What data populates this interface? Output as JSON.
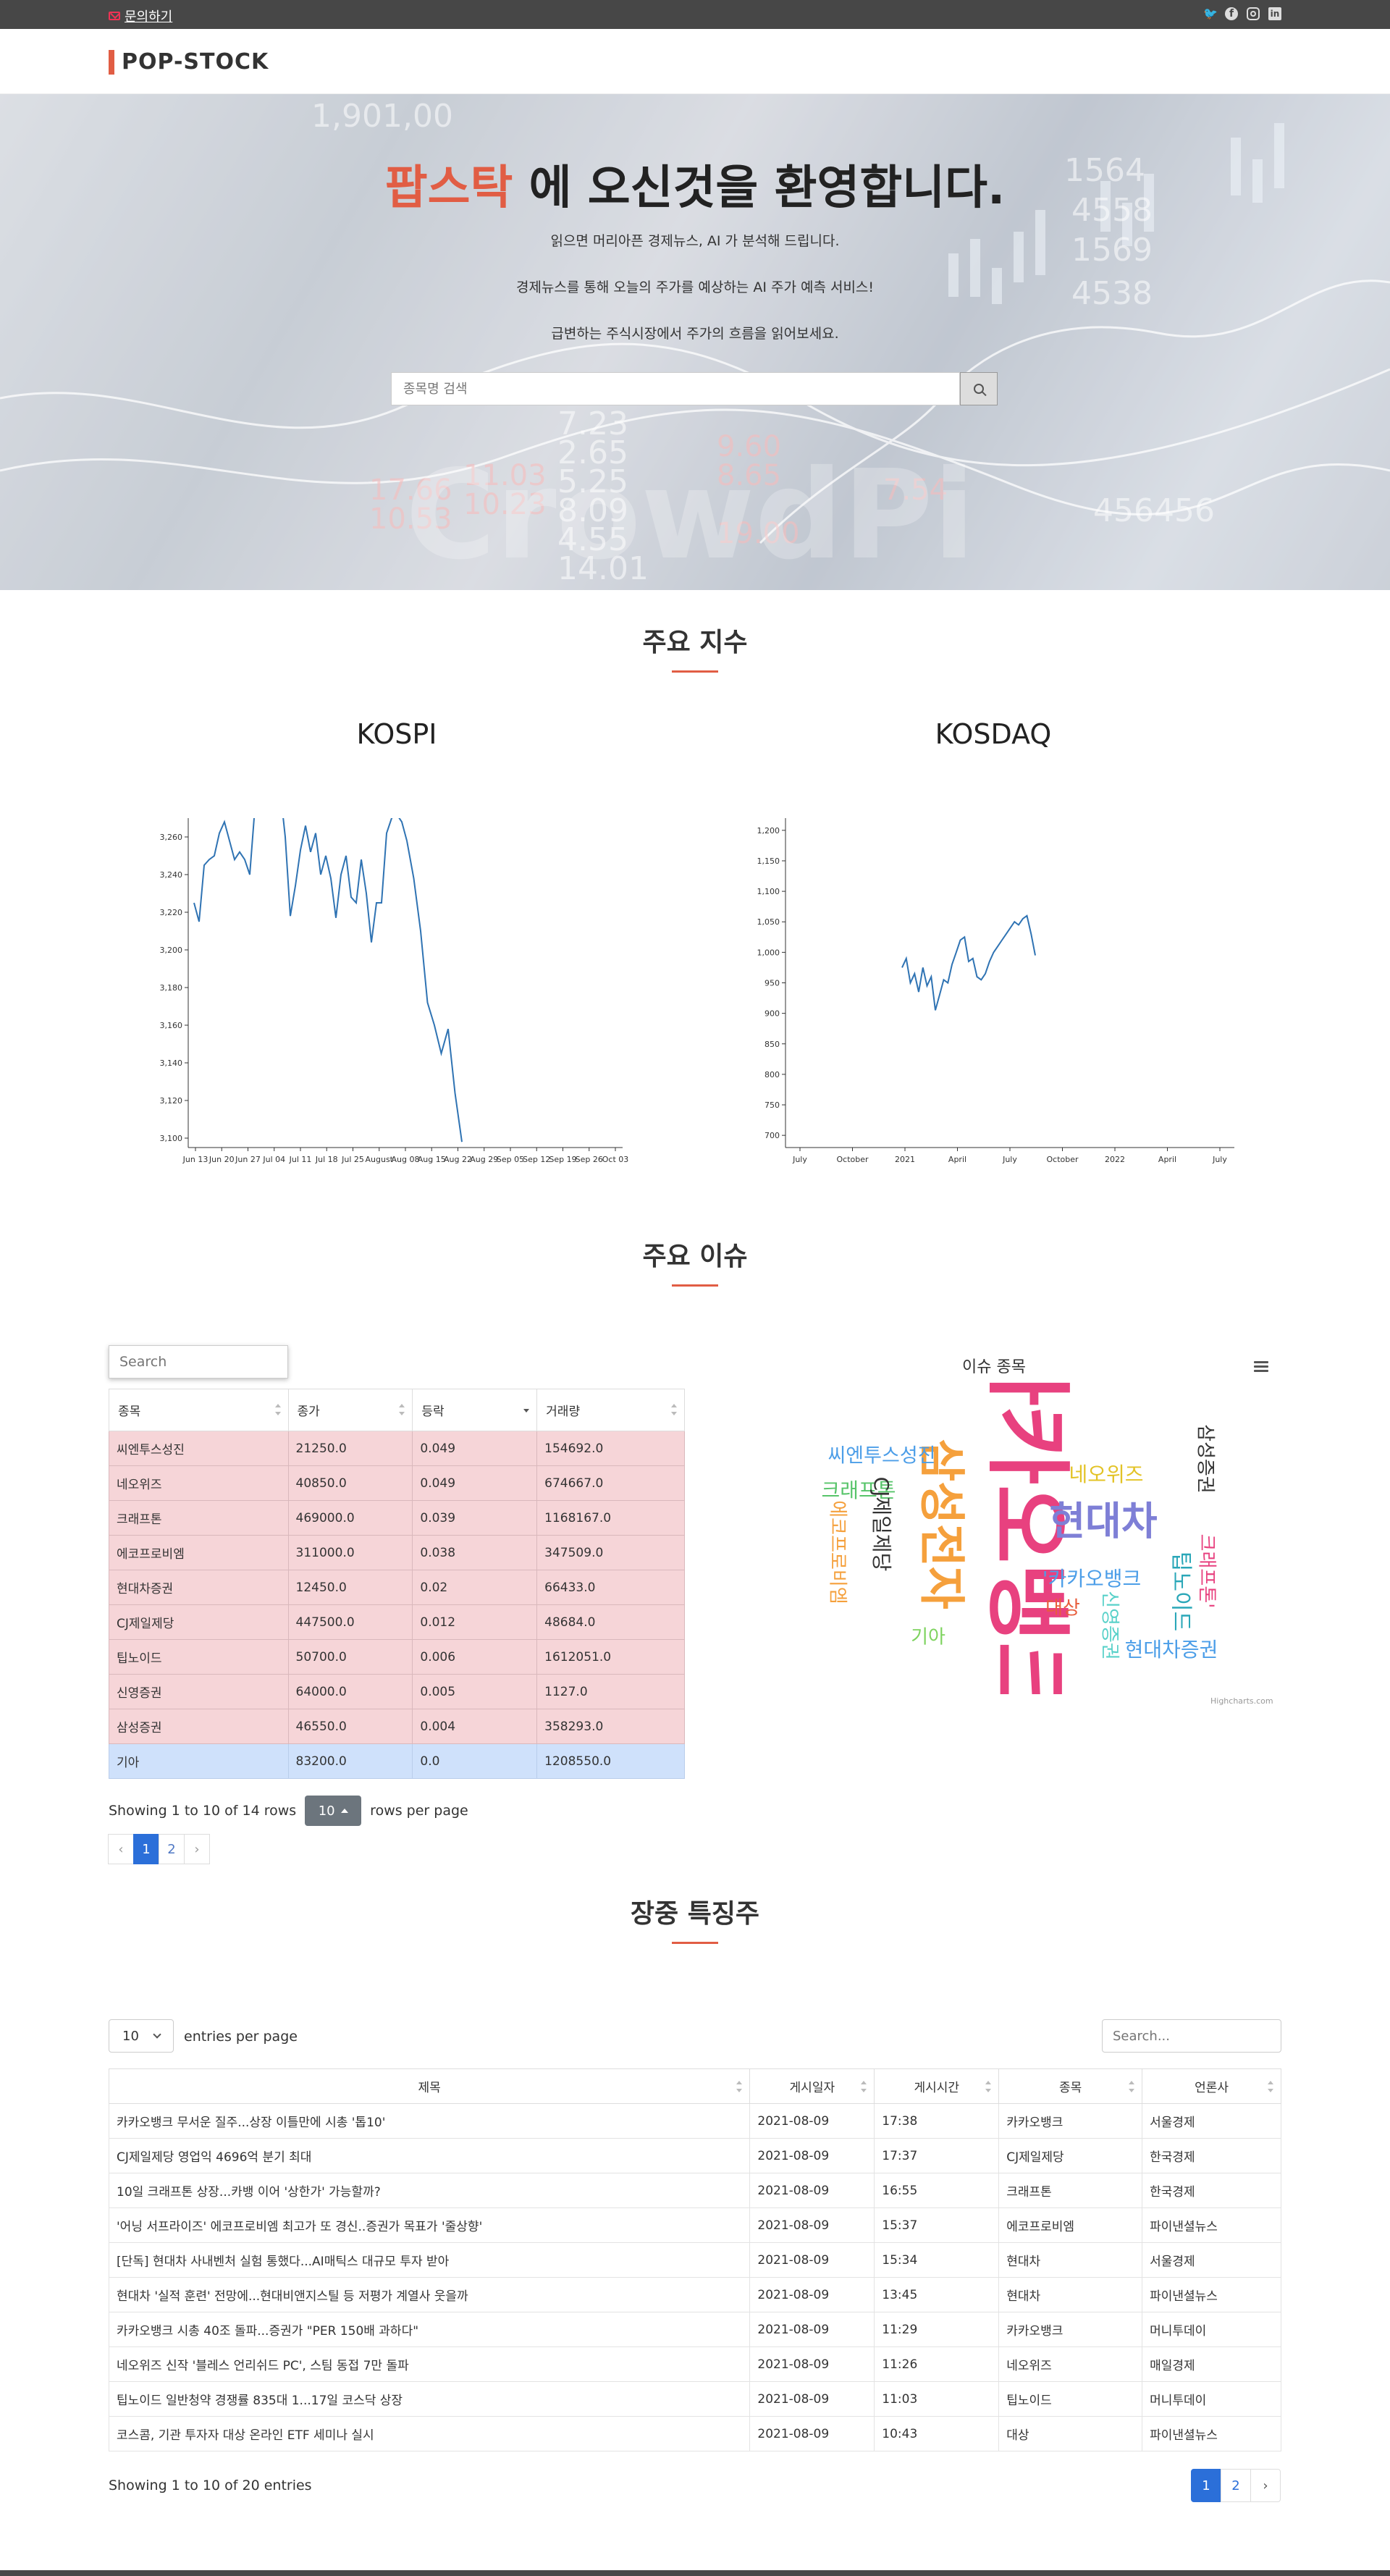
{
  "topbar": {
    "contact_label": "문의하기",
    "social_icons": [
      "twitter-icon",
      "facebook-icon",
      "instagram-icon",
      "linkedin-icon"
    ]
  },
  "header": {
    "logo": "POP-STOCK"
  },
  "hero": {
    "title_accent": "팝스탁",
    "title_rest": " 에 오신것을 환영합니다.",
    "lines": [
      "읽으면 머리아픈 경제뉴스, AI 가 분석해 드립니다.",
      "경제뉴스를 통해 오늘의 주가를 예상하는 AI 주가 예측 서비스!",
      "급변하는 주식시장에서 주가의 흐름을 읽어보세요."
    ],
    "search_placeholder": "종목명 검색"
  },
  "section_indices": {
    "title": "주요 지수"
  },
  "chart_data": [
    {
      "type": "line",
      "title": "KOSPI",
      "x_ticks": [
        "Jun 13",
        "Jun 20",
        "Jun 27",
        "Jul 04",
        "Jul 11",
        "Jul 18",
        "Jul 25",
        "August",
        "Aug 08",
        "Aug 15",
        "Aug 22",
        "Aug 29",
        "Sep 05",
        "Sep 12",
        "Sep 19",
        "Sep 26",
        "Oct 03"
      ],
      "y_ticks": [
        3100,
        3120,
        3140,
        3160,
        3180,
        3200,
        3220,
        3240,
        3260
      ],
      "ylim": [
        3095,
        3270
      ],
      "x": [
        "Jun 10",
        "Jun 11",
        "Jun 14",
        "Jun 15",
        "Jun 16",
        "Jun 17",
        "Jun 18",
        "Jun 21",
        "Jun 22",
        "Jun 23",
        "Jun 24",
        "Jun 25",
        "Jun 28",
        "Jun 29",
        "Jun 30",
        "Jul 01",
        "Jul 02",
        "Jul 05",
        "Jul 06",
        "Jul 07",
        "Jul 08",
        "Jul 09",
        "Jul 12",
        "Jul 13",
        "Jul 14",
        "Jul 15",
        "Jul 16",
        "Jul 19",
        "Jul 20",
        "Jul 21",
        "Jul 22",
        "Jul 23",
        "Jul 26",
        "Jul 27",
        "Jul 28",
        "Jul 29",
        "Jul 30",
        "Aug 02",
        "Aug 03",
        "Aug 04",
        "Aug 05",
        "Aug 06",
        "Aug 09"
      ],
      "values": [
        3225,
        3215,
        3245,
        3248,
        3250,
        3262,
        3268,
        3258,
        3248,
        3252,
        3248,
        3240,
        3275,
        3280,
        3285,
        3282,
        3278,
        3285,
        3260,
        3218,
        3234,
        3253,
        3266,
        3252,
        3262,
        3240,
        3250,
        3238,
        3217,
        3240,
        3250,
        3228,
        3225,
        3248,
        3230,
        3204,
        3225,
        3225,
        3262,
        3270,
        3272,
        3268,
        3258
      ],
      "series_tail": {
        "x": [
          "Aug 09",
          "Aug 10",
          "Aug 11",
          "Aug 12",
          "Aug 13",
          "Aug 16",
          "Aug 17",
          "Aug 18",
          "Aug 19"
        ],
        "values": [
          3258,
          3238,
          3210,
          3172,
          3160,
          3145,
          3158,
          3124,
          3098
        ]
      }
    },
    {
      "type": "line",
      "title": "KOSDAQ",
      "x_ticks": [
        "July",
        "October",
        "2021",
        "April",
        "July",
        "October",
        "2022",
        "April",
        "July"
      ],
      "y_ticks": [
        700,
        750,
        800,
        850,
        900,
        950,
        1000,
        1050,
        1100,
        1150,
        1200
      ],
      "ylim": [
        680,
        1220
      ],
      "x": [
        "2021-01-04",
        "2021-01-11",
        "2021-01-18",
        "2021-01-25",
        "2021-02-01",
        "2021-02-08",
        "2021-02-15",
        "2021-02-22",
        "2021-03-01",
        "2021-03-08",
        "2021-03-15",
        "2021-03-22",
        "2021-03-29",
        "2021-04-05",
        "2021-04-12",
        "2021-04-19",
        "2021-04-26",
        "2021-05-03",
        "2021-05-10",
        "2021-05-17",
        "2021-05-24",
        "2021-05-31",
        "2021-06-07",
        "2021-06-14",
        "2021-06-21",
        "2021-06-28",
        "2021-07-05",
        "2021-07-12",
        "2021-07-19",
        "2021-07-26",
        "2021-08-02",
        "2021-08-09",
        "2021-08-16"
      ],
      "values": [
        975,
        990,
        950,
        965,
        935,
        975,
        945,
        960,
        905,
        930,
        955,
        950,
        980,
        1000,
        1020,
        1025,
        985,
        990,
        960,
        955,
        965,
        985,
        1000,
        1010,
        1020,
        1030,
        1040,
        1050,
        1045,
        1055,
        1060,
        1030,
        995
      ]
    }
  ],
  "section_issues": {
    "title": "주요 이슈"
  },
  "issues_table": {
    "search_placeholder": "Search",
    "columns": [
      "종목",
      "종가",
      "등락",
      "거래량"
    ],
    "rows": [
      [
        "씨엔투스성진",
        "21250.0",
        "0.049",
        "154692.0"
      ],
      [
        "네오위즈",
        "40850.0",
        "0.049",
        "674667.0"
      ],
      [
        "크래프톤",
        "469000.0",
        "0.039",
        "1168167.0"
      ],
      [
        "에코프로비엠",
        "311000.0",
        "0.038",
        "347509.0"
      ],
      [
        "현대차증권",
        "12450.0",
        "0.02",
        "66433.0"
      ],
      [
        "CJ제일제당",
        "447500.0",
        "0.012",
        "48684.0"
      ],
      [
        "팁노이드",
        "50700.0",
        "0.006",
        "1612051.0"
      ],
      [
        "신영증권",
        "64000.0",
        "0.005",
        "1127.0"
      ],
      [
        "삼성증권",
        "46550.0",
        "0.004",
        "358293.0"
      ],
      [
        "기아",
        "83200.0",
        "0.0",
        "1208550.0"
      ]
    ],
    "showing_prefix": "Showing 1 to 10 of 14 rows",
    "rows_per_page": "10",
    "rows_per_page_suffix": "rows per page",
    "pager": [
      "‹",
      "1",
      "2",
      "›"
    ]
  },
  "word_cloud": {
    "title": "이슈 종목",
    "credit": "Highcharts.com",
    "words": [
      {
        "text": "카카오뱅크",
        "color": "#e8417f"
      },
      {
        "text": "현대차",
        "color": "#7e7fd6"
      },
      {
        "text": "삼성전자",
        "color": "#f5a03c"
      },
      {
        "text": "씨엔투스성진",
        "color": "#4c9ee8"
      },
      {
        "text": "네오위즈",
        "color": "#e3c326"
      },
      {
        "text": "크래프톤",
        "color": "#57c46a"
      },
      {
        "text": "'카카오뱅크",
        "color": "#4c9ee8"
      },
      {
        "text": "CJ제일제당",
        "color": "#333333"
      },
      {
        "text": "에코프로비엠",
        "color": "#f5a03c"
      },
      {
        "text": "현대차증권",
        "color": "#4c9ee8"
      },
      {
        "text": "삼성증권",
        "color": "#333333"
      },
      {
        "text": "크래프톤'",
        "color": "#e8417f"
      },
      {
        "text": "팁노이드",
        "color": "#2aa7b8"
      },
      {
        "text": "신영증권",
        "color": "#58d1c9"
      },
      {
        "text": "기아",
        "color": "#7ed35f"
      },
      {
        "text": "대상",
        "color": "#e85d3c"
      }
    ]
  },
  "section_featured": {
    "title": "장중 특징주"
  },
  "news_table": {
    "length_value": "10",
    "length_label": "entries per page",
    "search_placeholder": "Search...",
    "columns": [
      "제목",
      "게시일자",
      "게시시간",
      "종목",
      "언론사"
    ],
    "rows": [
      [
        "카카오뱅크 무서운 질주...상장 이틀만에 시총 '톱10'",
        "2021-08-09",
        "17:38",
        "카카오뱅크",
        "서울경제"
      ],
      [
        "CJ제일제당 영업익 4696억 분기 최대",
        "2021-08-09",
        "17:37",
        "CJ제일제당",
        "한국경제"
      ],
      [
        "10일 크래프톤 상장...카뱅 이어 '상한가' 가능할까?",
        "2021-08-09",
        "16:55",
        "크래프톤",
        "한국경제"
      ],
      [
        "'어닝 서프라이즈' 에코프로비엠 최고가 또 경신..증권가 목표가 '줄상향'",
        "2021-08-09",
        "15:37",
        "에코프로비엠",
        "파이낸셜뉴스"
      ],
      [
        "[단독] 현대차 사내벤처 실험 통했다...AI매틱스 대규모 투자 받아",
        "2021-08-09",
        "15:34",
        "현대차",
        "서울경제"
      ],
      [
        "현대차 '실적 훈련' 전망에...현대비앤지스틸 등 저평가 계열사 웃을까",
        "2021-08-09",
        "13:45",
        "현대차",
        "파이낸셜뉴스"
      ],
      [
        "카카오뱅크 시총 40조 돌파...증권가 \"PER 150배 과하다\"",
        "2021-08-09",
        "11:29",
        "카카오뱅크",
        "머니투데이"
      ],
      [
        "네오위즈 신작 '블레스 언리쉬드 PC', 스팀 동접 7만 돌파",
        "2021-08-09",
        "11:26",
        "네오위즈",
        "매일경제"
      ],
      [
        "팁노이드 일반청약 경쟁률 835대 1...17일 코스닥 상장",
        "2021-08-09",
        "11:03",
        "팁노이드",
        "머니투데이"
      ],
      [
        "코스콤, 기관 투자자 대상 온라인 ETF 세미나 실시",
        "2021-08-09",
        "10:43",
        "대상",
        "파이낸셜뉴스"
      ]
    ],
    "showing": "Showing 1 to 10 of 20 entries",
    "pager": [
      "1",
      "2",
      "›"
    ]
  }
}
